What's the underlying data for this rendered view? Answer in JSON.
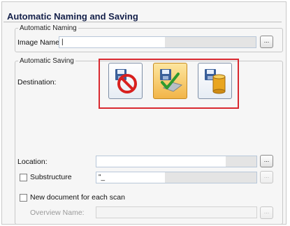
{
  "section_title": "Automatic Naming and Saving",
  "naming": {
    "legend": "Automatic Naming",
    "image_name_label": "Image Name:",
    "image_name_value": "|",
    "browse_label": "..."
  },
  "saving": {
    "legend": "Automatic Saving",
    "destination_label": "Destination:",
    "destinations": [
      {
        "name": "no-save",
        "selected": false
      },
      {
        "name": "save-to-disk",
        "selected": true
      },
      {
        "name": "save-to-database",
        "selected": false
      }
    ],
    "location_label": "Location:",
    "location_value": "",
    "location_browse": "...",
    "substructure_label": "Substructure",
    "substructure_value": "\"_",
    "substructure_browse": "...",
    "new_doc_label": "New document for each scan",
    "overview_label": "Overview Name:",
    "overview_browse": "..."
  },
  "colors": {
    "highlight": "#d9282f",
    "selected_button": "#f2b548",
    "title": "#14204a"
  }
}
